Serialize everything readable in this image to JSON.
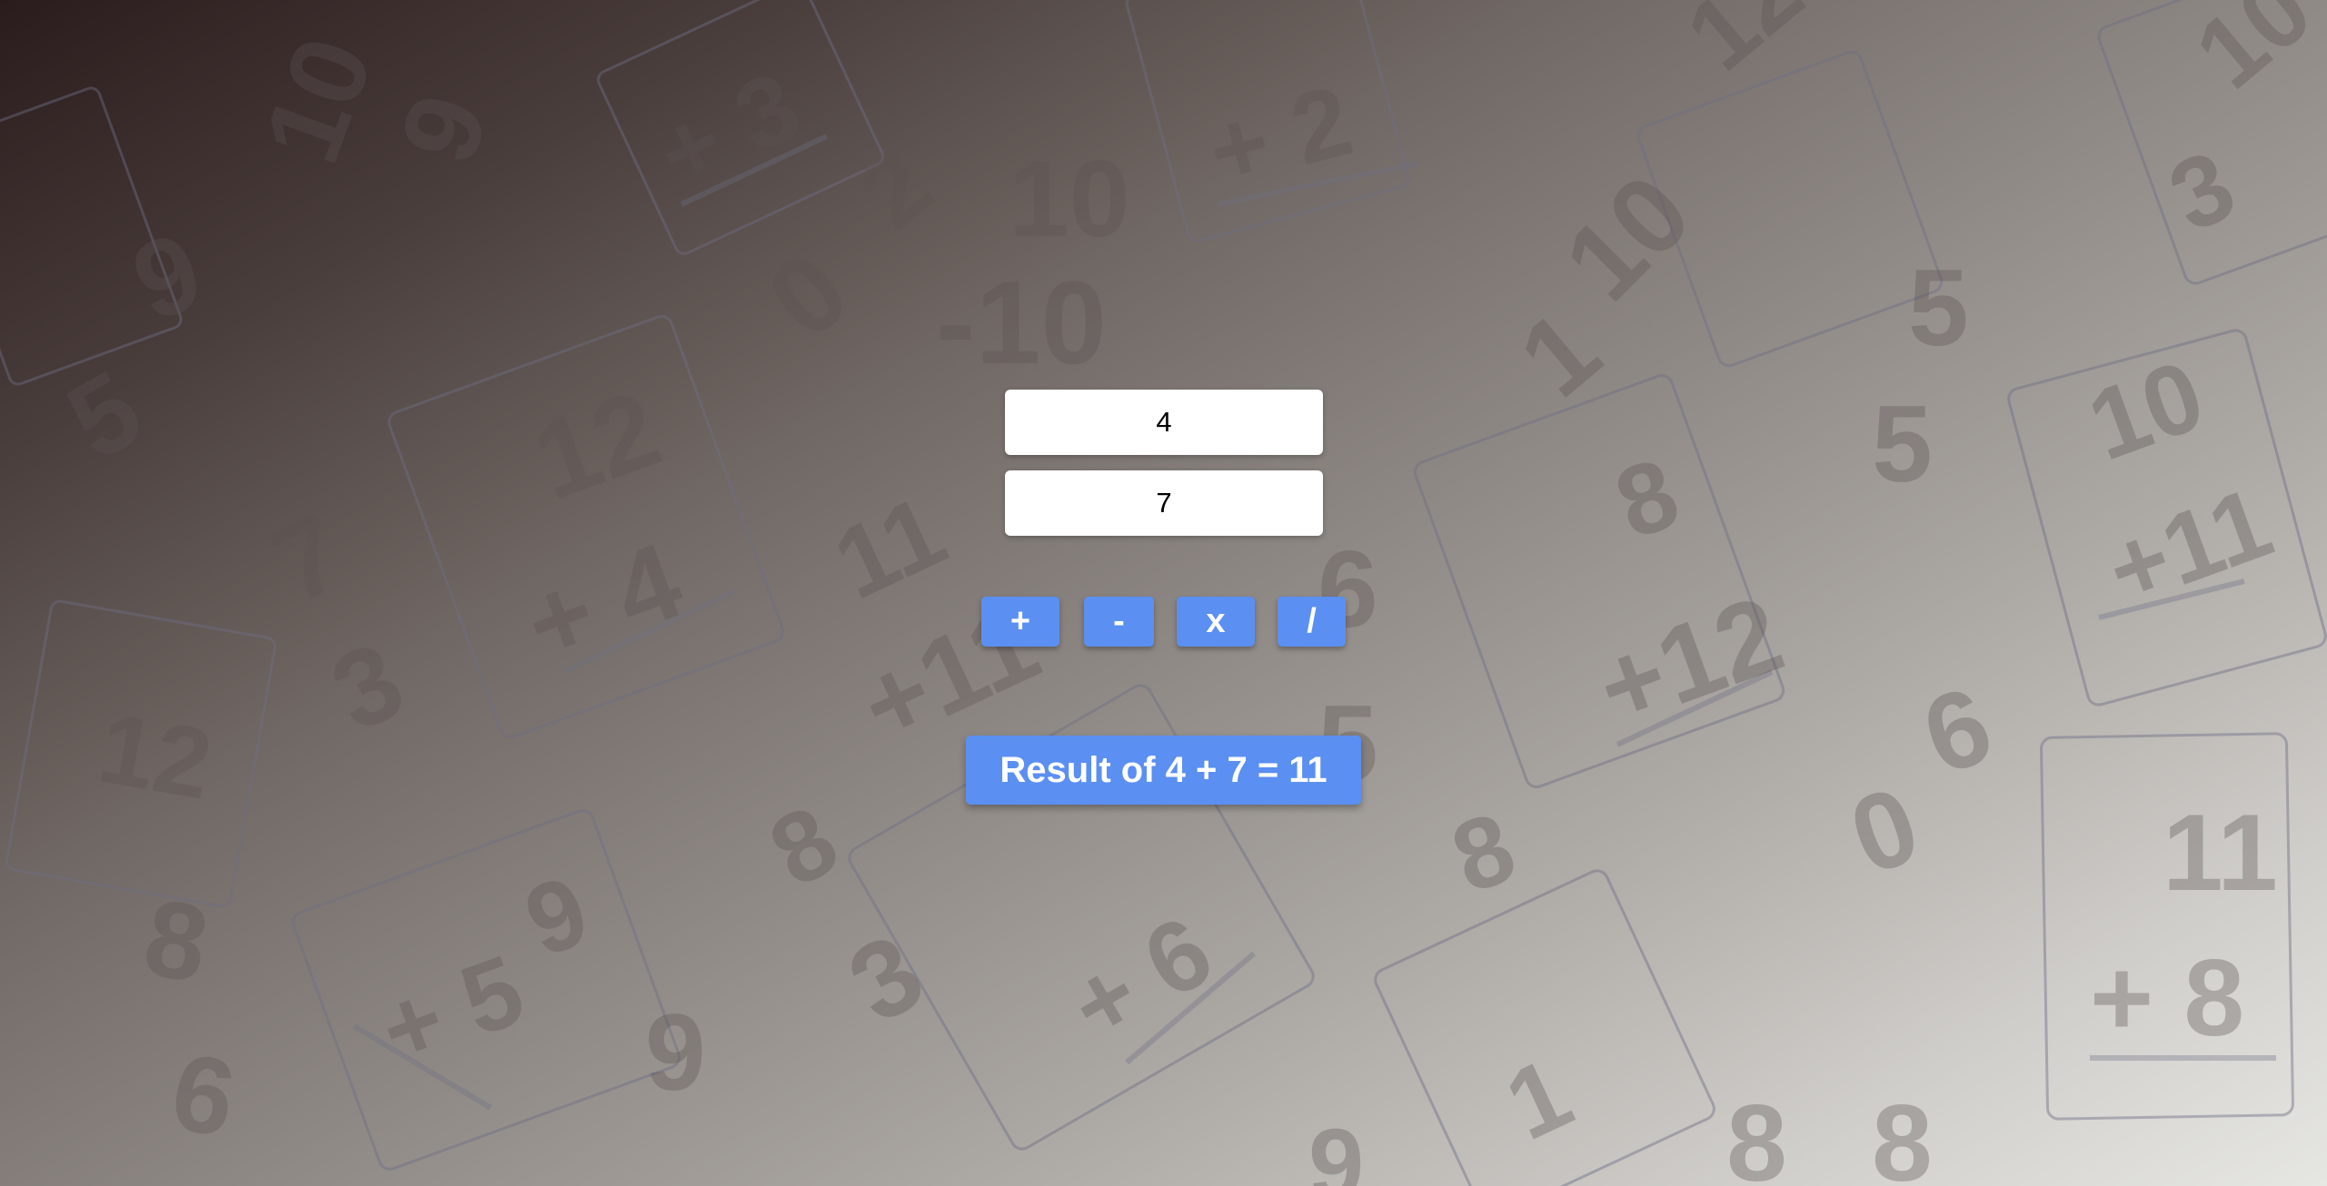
{
  "inputs": {
    "a_value": "4",
    "b_value": "7"
  },
  "operators": {
    "add": "+",
    "subtract": "-",
    "multiply": "x",
    "divide": "/"
  },
  "result": {
    "text": "Result of 4 + 7 = 11"
  },
  "background": {
    "flashcard_texts": [
      "10",
      "9",
      "+ 3",
      "2",
      "0",
      "10",
      "-10",
      "+ 2",
      "12",
      "10",
      "1",
      "3",
      "7",
      "5",
      "9",
      "5",
      "12",
      "+ 4",
      "7",
      "3",
      "11",
      "+11",
      "8",
      "+12",
      "5",
      "10",
      "+11",
      "6",
      "0",
      "12",
      "8",
      "6",
      "9",
      "8",
      "3",
      "+ 6",
      "9",
      "8",
      "11",
      "+ 8",
      "5",
      "8",
      "1",
      "9"
    ],
    "colors": {
      "card_border": "#6f7088",
      "digit": "#5d5656"
    }
  },
  "colors": {
    "button": "#5b8ff2",
    "button_text": "#ffffff",
    "input_bg": "#ffffff"
  }
}
